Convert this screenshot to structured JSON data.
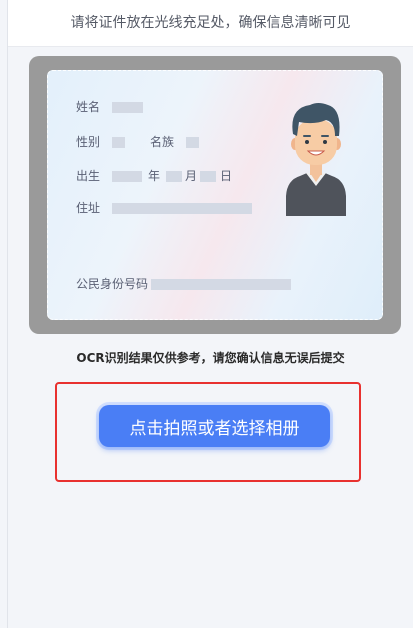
{
  "header": {
    "hint": "请将证件放在光线充足处，确保信息清晰可见"
  },
  "id_card_sample": {
    "name_label": "姓名",
    "gender_label": "性别",
    "ethnicity_label": "名族",
    "birth_label": "出生",
    "year_label": "年",
    "month_label": "月",
    "day_label": "日",
    "address_label": "住址",
    "id_number_label": "公民身份号码",
    "avatar_icon": "person-portrait-icon"
  },
  "notice": {
    "text": "OCR识别结果仅供参考，请您确认信息无误后提交"
  },
  "actions": {
    "capture_label": "点击拍照或者选择相册"
  },
  "colors": {
    "primary_button": "#4a7ef5",
    "highlight_border": "#e8312f",
    "frame_background": "#9a9a9a"
  }
}
